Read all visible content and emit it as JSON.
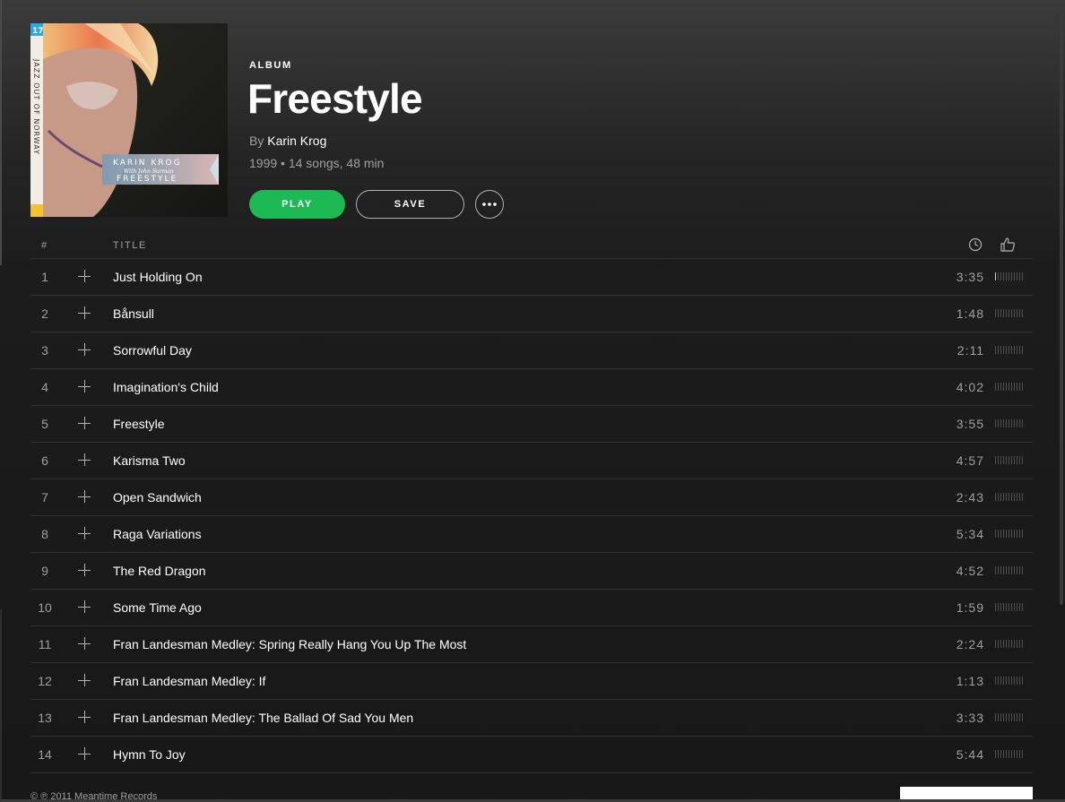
{
  "album": {
    "type_label": "ALBUM",
    "title": "Freestyle",
    "by_prefix": "By",
    "artist": "Karin Krog",
    "meta": "1999 • 14 songs, 48 min",
    "cover_text": {
      "badge": "17",
      "artist": "KARIN KROG",
      "with": "With John Surman",
      "title": "FREESTYLE",
      "series": "JAZZ OUT OF NORWAY"
    }
  },
  "actions": {
    "play_label": "PLAY",
    "save_label": "SAVE"
  },
  "tracklist": {
    "header": {
      "number": "#",
      "title": "TITLE"
    },
    "tracks": [
      {
        "number": "1",
        "title": "Just Holding On",
        "duration": "3:35",
        "popularity": 1
      },
      {
        "number": "2",
        "title": "Bånsull",
        "duration": "1:48",
        "popularity": 0
      },
      {
        "number": "3",
        "title": "Sorrowful Day",
        "duration": "2:11",
        "popularity": 0
      },
      {
        "number": "4",
        "title": "Imagination's Child",
        "duration": "4:02",
        "popularity": 0
      },
      {
        "number": "5",
        "title": "Freestyle",
        "duration": "3:55",
        "popularity": 0
      },
      {
        "number": "6",
        "title": "Karisma Two",
        "duration": "4:57",
        "popularity": 0
      },
      {
        "number": "7",
        "title": "Open Sandwich",
        "duration": "2:43",
        "popularity": 0
      },
      {
        "number": "8",
        "title": "Raga Variations",
        "duration": "5:34",
        "popularity": 0
      },
      {
        "number": "9",
        "title": "The Red Dragon",
        "duration": "4:52",
        "popularity": 0
      },
      {
        "number": "10",
        "title": "Some Time Ago",
        "duration": "1:59",
        "popularity": 0
      },
      {
        "number": "11",
        "title": "Fran Landesman Medley: Spring Really Hang You Up The Most",
        "duration": "2:24",
        "popularity": 0
      },
      {
        "number": "12",
        "title": "Fran Landesman Medley: If",
        "duration": "1:13",
        "popularity": 0
      },
      {
        "number": "13",
        "title": "Fran Landesman Medley: The Ballad Of Sad You Men",
        "duration": "3:33",
        "popularity": 0
      },
      {
        "number": "14",
        "title": "Hymn To Joy",
        "duration": "5:44",
        "popularity": 0
      }
    ]
  },
  "footer": {
    "copyright": "© ℗ 2011 Meantime Records"
  },
  "colors": {
    "accent": "#1db954",
    "background": "#181818",
    "text_muted": "#a0a0a0"
  },
  "icons": [
    "clock-icon",
    "thumbs-up-icon",
    "more-icon",
    "add-icon"
  ]
}
